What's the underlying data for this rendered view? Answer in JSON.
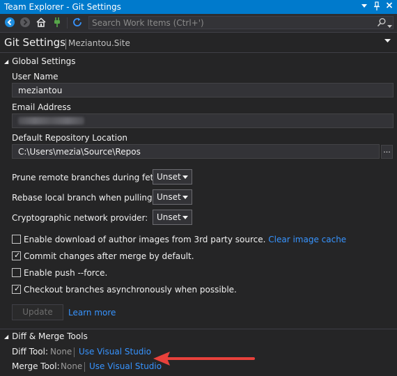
{
  "titlebar": {
    "title": "Team Explorer - Git Settings",
    "dropdown_glyph": "▾",
    "pin_glyph": "📌",
    "close_glyph": "✕"
  },
  "toolbar": {
    "buttons": [
      "back-icon",
      "forward-icon",
      "home-icon",
      "connect-icon",
      "refresh-icon"
    ],
    "search_placeholder": "Search Work Items (Ctrl+')"
  },
  "header": {
    "title": "Git Settings",
    "site": "Meziantou.Site"
  },
  "global": {
    "title": "Global Settings",
    "user_name_label": "User Name",
    "user_name_value": "meziantou",
    "email_label": "Email Address",
    "repo_location_label": "Default Repository Location",
    "repo_location_value": "C:\\Users\\mezia\\Source\\Repos",
    "browse_label": "...",
    "prune_label": "Prune remote branches during fetch:",
    "prune_value": "Unset",
    "rebase_label": "Rebase local branch when pulling:",
    "rebase_value": "Unset",
    "crypto_label": "Cryptographic network provider:",
    "crypto_value": "Unset",
    "cb_author_images": {
      "label": "Enable download of author images from 3rd party source.",
      "checked": false,
      "link": "Clear image cache"
    },
    "cb_commit_after_merge": {
      "label": "Commit changes after merge by default.",
      "checked": true
    },
    "cb_push_force": {
      "label": "Enable push --force.",
      "checked": false
    },
    "cb_checkout_async": {
      "label": "Checkout branches asynchronously when possible.",
      "checked": true
    },
    "update_label": "Update",
    "learn_more": "Learn more"
  },
  "diff": {
    "title": "Diff & Merge Tools",
    "diff_tool_label": "Diff Tool:",
    "diff_tool_value": "None",
    "diff_tool_link": "Use Visual Studio",
    "merge_tool_label": "Merge Tool:",
    "merge_tool_value": "None",
    "merge_tool_link": "Use Visual Studio"
  },
  "colors": {
    "accent": "#007acc",
    "link": "#3794ff",
    "arrow": "#e8413b",
    "background": "#252526"
  }
}
